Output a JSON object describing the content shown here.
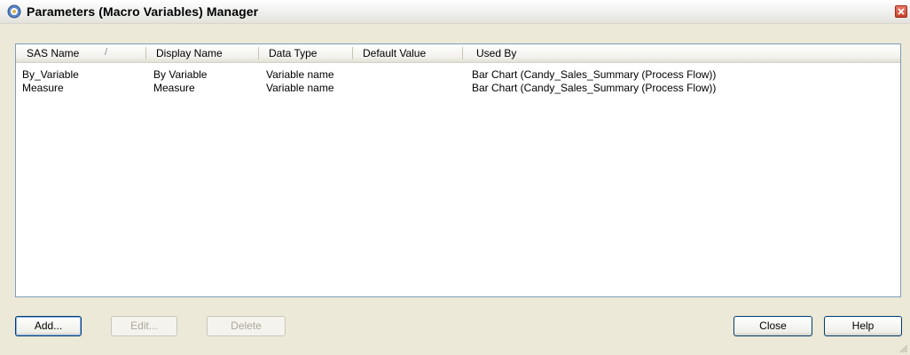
{
  "window": {
    "title": "Parameters (Macro Variables) Manager"
  },
  "columns": [
    {
      "label": "SAS Name",
      "sort": "/"
    },
    {
      "label": "Display Name"
    },
    {
      "label": "Data Type"
    },
    {
      "label": "Default Value"
    },
    {
      "label": "Used By"
    }
  ],
  "rows": [
    {
      "sas_name": "By_Variable",
      "display_name": "By Variable",
      "data_type": "Variable name",
      "default_value": "",
      "used_by": "Bar Chart (Candy_Sales_Summary (Process Flow))"
    },
    {
      "sas_name": "Measure",
      "display_name": "Measure",
      "data_type": "Variable name",
      "default_value": "",
      "used_by": "Bar Chart (Candy_Sales_Summary (Process Flow))"
    }
  ],
  "buttons": {
    "add": "Add...",
    "edit": "Edit...",
    "delete": "Delete",
    "close": "Close",
    "help": "Help"
  }
}
